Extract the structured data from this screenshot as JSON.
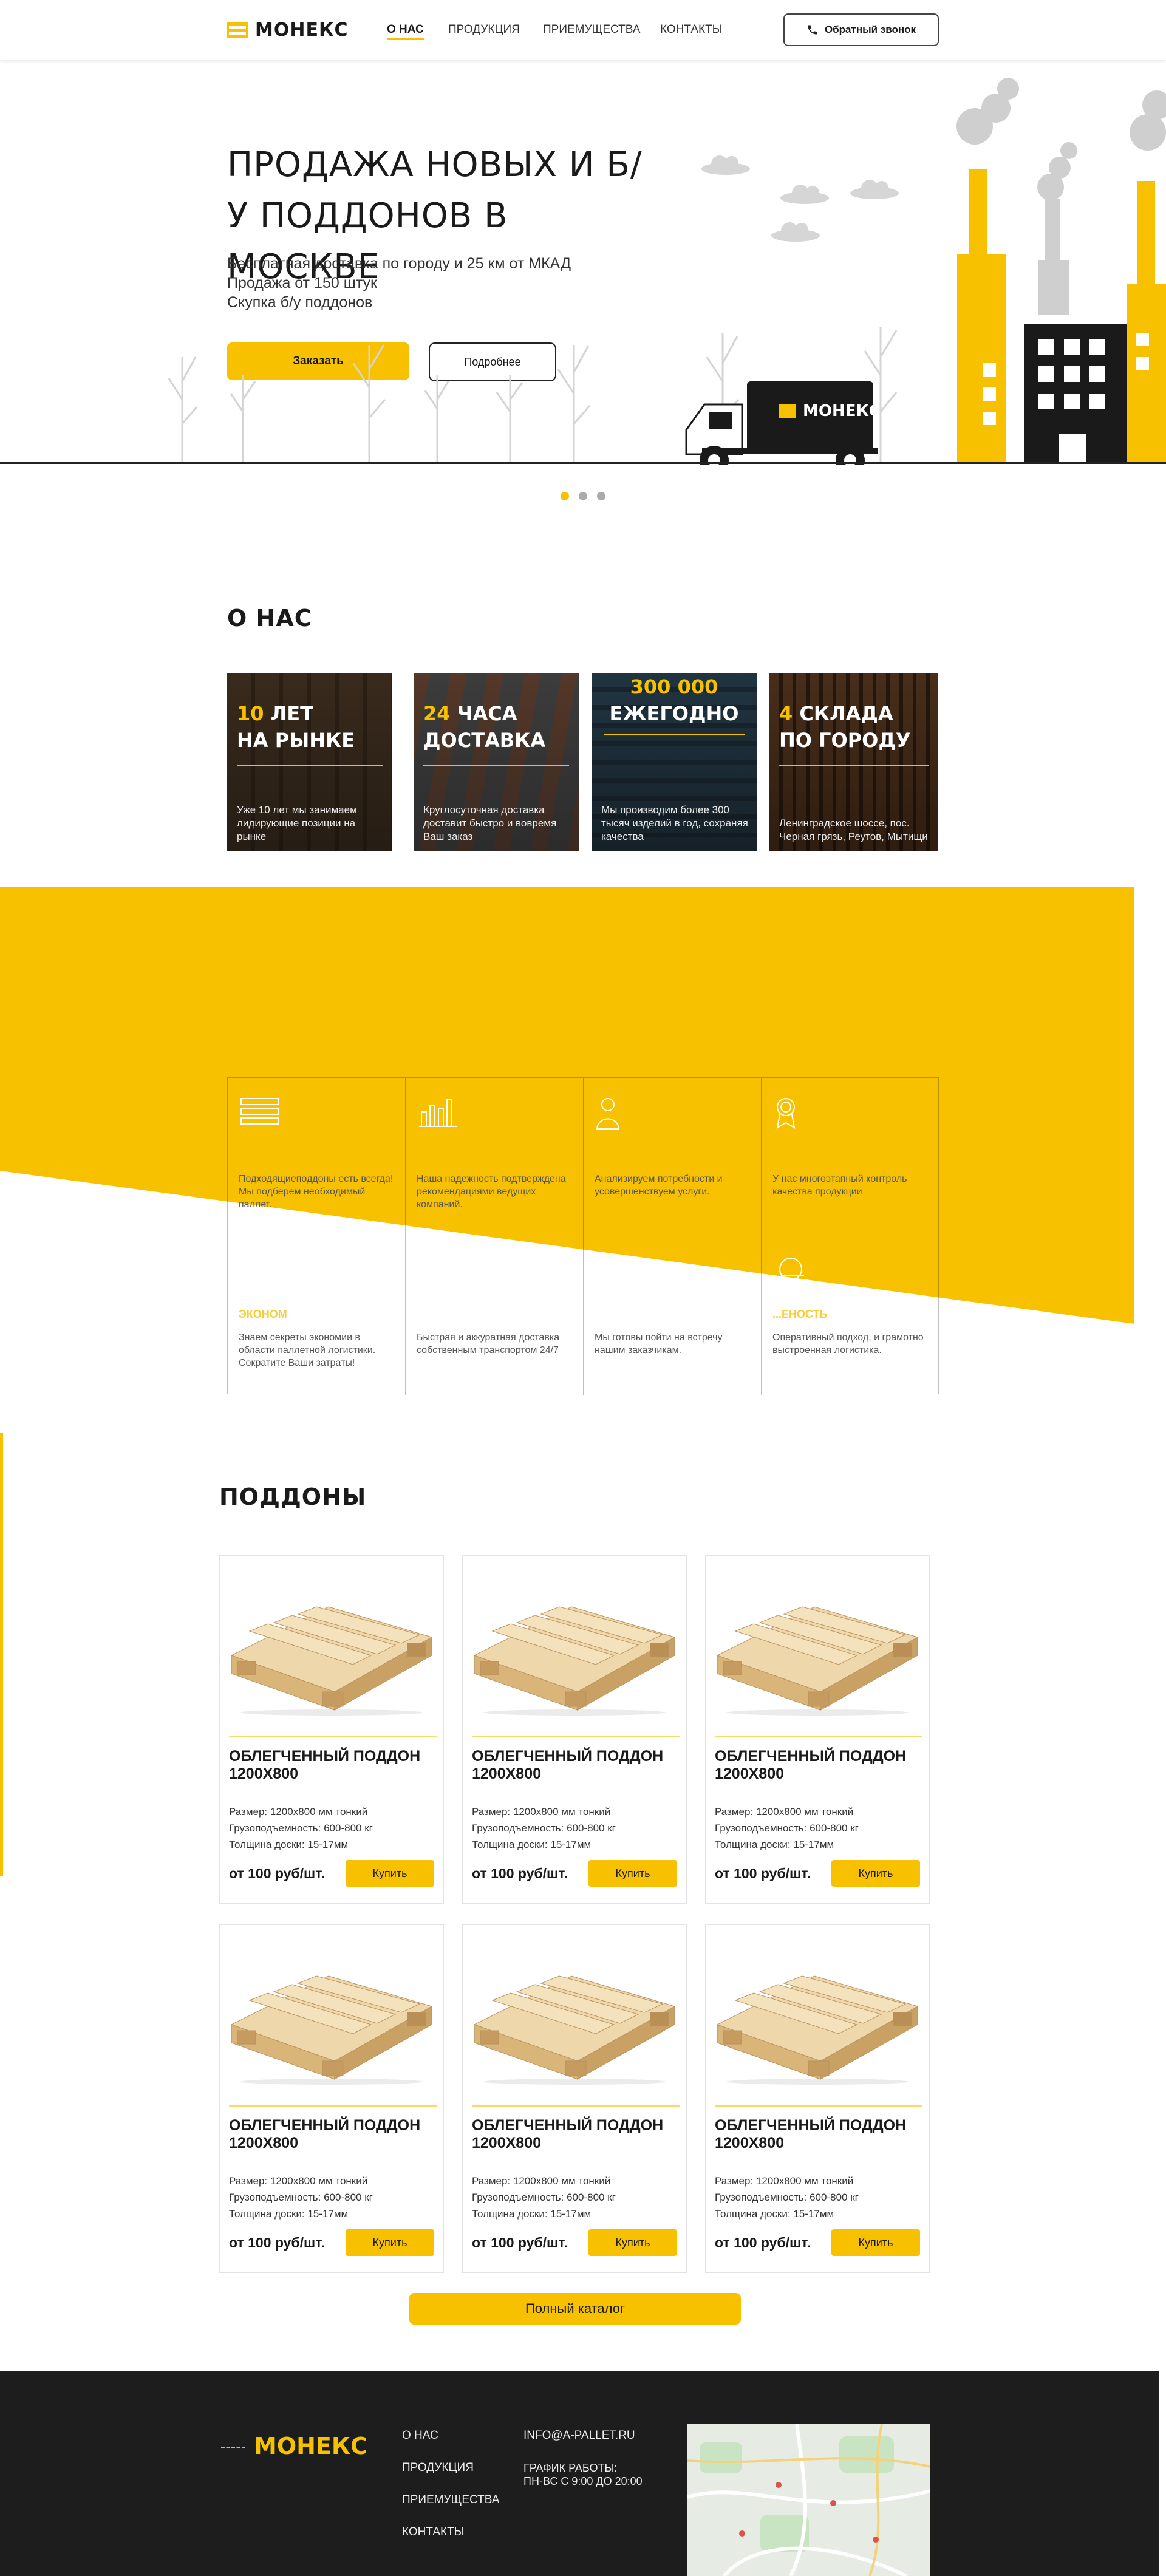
{
  "header": {
    "brand": "МОНЕКС",
    "nav": [
      "О НАС",
      "ПРОДУКЦИЯ",
      "ПРИЕМУЩЕСТВА",
      "КОНТАКТЫ"
    ],
    "callback_label": "Обратный звонок"
  },
  "hero": {
    "title": "ПРОДАЖА НОВЫХ И Б/У ПОДДОНОВ В МОСКВЕ",
    "lines": [
      "Бесплатная доставка по городу и 25 км от МКАД",
      "Продажа от 150 штук",
      "Скупка б/у поддонов"
    ],
    "order_label": "Заказать",
    "more_label": "Подробнее",
    "truck_brand": "МОНЕКС",
    "slides": 3,
    "active_slide": 0
  },
  "about": {
    "heading": "О НАС",
    "cards": [
      {
        "num": "10",
        "line1": "ЛЕТ",
        "line2": "НА РЫНКЕ",
        "desc": "Уже 10 лет мы занимаем лидирующие позиции на рынке"
      },
      {
        "num": "24",
        "line1": "ЧАСА",
        "line2": "ДОСТАВКА",
        "desc": "Круглосуточная доставка доставит быстро и вовремя Ваш заказ"
      },
      {
        "num": "300 000",
        "line1": "",
        "line2": "ЕЖЕГОДНО",
        "desc": "Мы производим более 300 тысяч изделий в год, сохраняя качества"
      },
      {
        "num": "4",
        "line1": "СКЛАДА",
        "line2": "ПО ГОРОДУ",
        "desc": "Ленинградское шоссе, пос. Черная грязь, Реутов, Мытищи"
      }
    ]
  },
  "features": [
    {
      "icon": "pallet-stack-icon",
      "title": "",
      "text": "Подходящиеподдоны есть всегда! Мы подберем необходимый паллет."
    },
    {
      "icon": "bar-chart-icon",
      "title": "",
      "text": "Наша надежность подтверждена рекомендациями ведущих компаний."
    },
    {
      "icon": "person-icon",
      "title": "",
      "text": "Анализируем потребности и усовершенствуем услуги."
    },
    {
      "icon": "award-icon",
      "title": "",
      "text": "У нас многоэтапный контроль качества продукции"
    },
    {
      "icon": "coins-icon",
      "title": "ЭКОНОМ",
      "text": "Знаем секреты экономии в области паллетной логистики. Сократите Ваши затраты!"
    },
    {
      "icon": "truck-icon",
      "title": "",
      "text": "Быстрая и аккуратная доставка собственным транспортом 24/7"
    },
    {
      "icon": "handshake-icon",
      "title": "",
      "text": "Мы готовы пойти на встречу нашим заказчикам."
    },
    {
      "icon": "service-icon",
      "title": "...ЕНОСТЬ",
      "text": "Оперативный подход, и грамотно выстроенная логистика."
    }
  ],
  "products": {
    "heading": "ПОДДОНЫ",
    "items": [
      {
        "name": "ОБЛЕГЧЕННЫЙ ПОДДОН 1200X800",
        "size": "Размер: 1200х800 мм тонкий",
        "load": "Грузоподъемность: 600-800 кг",
        "thick": "Толщина доски: 15-17мм",
        "price": "от 100 руб/шт.",
        "buy": "Купить"
      },
      {
        "name": "ОБЛЕГЧЕННЫЙ ПОДДОН 1200X800",
        "size": "Размер: 1200х800 мм тонкий",
        "load": "Грузоподъемность: 600-800 кг",
        "thick": "Толщина доски: 15-17мм",
        "price": "от 100 руб/шт.",
        "buy": "Купить"
      },
      {
        "name": "ОБЛЕГЧЕННЫЙ ПОДДОН 1200X800",
        "size": "Размер: 1200х800 мм тонкий",
        "load": "Грузоподъемность: 600-800 кг",
        "thick": "Толщина доски: 15-17мм",
        "price": "от 100 руб/шт.",
        "buy": "Купить"
      },
      {
        "name": "ОБЛЕГЧЕННЫЙ ПОДДОН 1200X800",
        "size": "Размер: 1200х800 мм тонкий",
        "load": "Грузоподъемность: 600-800 кг",
        "thick": "Толщина доски: 15-17мм",
        "price": "от 100 руб/шт.",
        "buy": "Купить"
      },
      {
        "name": "ОБЛЕГЧЕННЫЙ ПОДДОН 1200X800",
        "size": "Размер: 1200х800 мм тонкий",
        "load": "Грузоподъемность: 600-800 кг",
        "thick": "Толщина доски: 15-17мм",
        "price": "от 100 руб/шт.",
        "buy": "Купить"
      },
      {
        "name": "ОБЛЕГЧЕННЫЙ ПОДДОН 1200X800",
        "size": "Размер: 1200х800 мм тонкий",
        "load": "Грузоподъемность: 600-800 кг",
        "thick": "Толщина доски: 15-17мм",
        "price": "от 100 руб/шт.",
        "buy": "Купить"
      }
    ],
    "catalog_label": "Полный каталог"
  },
  "footer": {
    "brand": "МОНЕКС",
    "links": [
      "О НАС",
      "ПРОДУКЦИЯ",
      "ПРИЕМУЩЕСТВА",
      "КОНТАКТЫ"
    ],
    "email": "INFO@A-PALLET.RU",
    "hours_label": "ГРАФИК РАБОТЫ:",
    "hours": "ПН-ВС С 9:00 ДО 20:00"
  },
  "colors": {
    "accent": "#f7c100",
    "dark": "#1d1d1d"
  }
}
